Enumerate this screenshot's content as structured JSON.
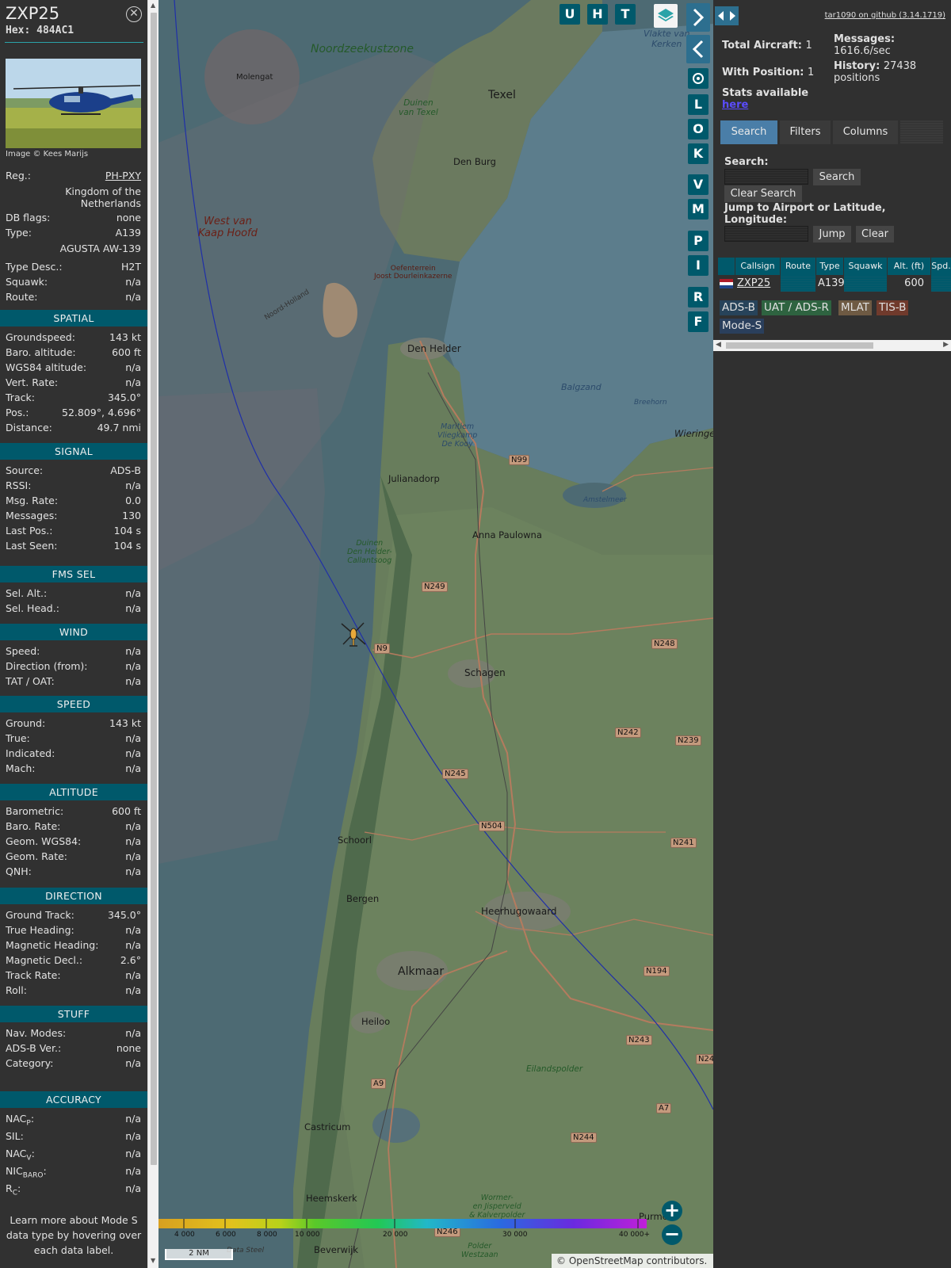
{
  "aircraft": {
    "callsign": "ZXP25",
    "hex": "Hex: 484AC1",
    "image_credit": "Image © Kees Marijs",
    "reg_label": "Reg.:",
    "reg": "PH-PXY",
    "country": "Kingdom of the Netherlands",
    "dbflags_label": "DB flags:",
    "dbflags": "none",
    "type_label": "Type:",
    "type": "A139",
    "type_full": "AGUSTA AW-139",
    "typedesc_label": "Type Desc.:",
    "typedesc": "H2T",
    "squawk_label": "Squawk:",
    "squawk": "n/a",
    "route_label": "Route:",
    "route": "n/a"
  },
  "sections": {
    "spatial": "SPATIAL",
    "signal": "SIGNAL",
    "fms": "FMS SEL",
    "wind": "WIND",
    "speed": "SPEED",
    "altitude": "ALTITUDE",
    "direction": "DIRECTION",
    "stuff": "STUFF",
    "accuracy": "ACCURACY"
  },
  "spatial": [
    {
      "label": "Groundspeed:",
      "value": "143 kt"
    },
    {
      "label": "Baro. altitude:",
      "value": "600 ft"
    },
    {
      "label": "WGS84 altitude:",
      "value": "n/a"
    },
    {
      "label": "Vert. Rate:",
      "value": "n/a"
    },
    {
      "label": "Track:",
      "value": "345.0°"
    },
    {
      "label": "Pos.:",
      "value": "52.809°, 4.696°"
    },
    {
      "label": "Distance:",
      "value": "49.7 nmi"
    }
  ],
  "signal": [
    {
      "label": "Source:",
      "value": "ADS-B"
    },
    {
      "label": "RSSI:",
      "value": "n/a"
    },
    {
      "label": "Msg. Rate:",
      "value": "0.0"
    },
    {
      "label": "Messages:",
      "value": "130"
    },
    {
      "label": "Last Pos.:",
      "value": "104 s"
    },
    {
      "label": "Last Seen:",
      "value": "104 s"
    }
  ],
  "fms": [
    {
      "label": "Sel. Alt.:",
      "value": "n/a"
    },
    {
      "label": "Sel. Head.:",
      "value": "n/a"
    }
  ],
  "wind": [
    {
      "label": "Speed:",
      "value": "n/a"
    },
    {
      "label": "Direction (from):",
      "value": "n/a"
    },
    {
      "label": "TAT / OAT:",
      "value": "n/a"
    }
  ],
  "speed": [
    {
      "label": "Ground:",
      "value": "143 kt"
    },
    {
      "label": "True:",
      "value": "n/a"
    },
    {
      "label": "Indicated:",
      "value": "n/a"
    },
    {
      "label": "Mach:",
      "value": "n/a"
    }
  ],
  "altitude": [
    {
      "label": "Barometric:",
      "value": "600 ft"
    },
    {
      "label": "Baro. Rate:",
      "value": "n/a"
    },
    {
      "label": "Geom. WGS84:",
      "value": "n/a"
    },
    {
      "label": "Geom. Rate:",
      "value": "n/a"
    },
    {
      "label": "QNH:",
      "value": "n/a"
    }
  ],
  "direction": [
    {
      "label": "Ground Track:",
      "value": "345.0°"
    },
    {
      "label": "True Heading:",
      "value": "n/a"
    },
    {
      "label": "Magnetic Heading:",
      "value": "n/a"
    },
    {
      "label": "Magnetic Decl.:",
      "value": "2.6°"
    },
    {
      "label": "Track Rate:",
      "value": "n/a"
    },
    {
      "label": "Roll:",
      "value": "n/a"
    }
  ],
  "stuff": [
    {
      "label": "Nav. Modes:",
      "value": "n/a"
    },
    {
      "label": "ADS-B Ver.:",
      "value": "none"
    },
    {
      "label": "Category:",
      "value": "n/a"
    }
  ],
  "accuracy": [
    {
      "label": "NAC",
      "sub": "P",
      "value": "n/a"
    },
    {
      "label": "SIL:",
      "sub": "",
      "value": "n/a"
    },
    {
      "label": "NAC",
      "sub": "V",
      "value": "n/a"
    },
    {
      "label": "NIC",
      "sub": "BARO",
      "value": "n/a"
    },
    {
      "label": "R",
      "sub": "C",
      "value": "n/a"
    }
  ],
  "footnote": "Learn more about Mode S data type by hovering over each data label.",
  "map": {
    "buttons_top": [
      "U",
      "H",
      "T"
    ],
    "buttons_side": [
      "L",
      "O",
      "K",
      "V",
      "M",
      "P",
      "I",
      "R",
      "F"
    ],
    "labels": {
      "noordzeekustzone": "Noordzeekustzone",
      "molengat": "Molengat",
      "texel": "Texel",
      "duinen_texel": "Duinen\nvan Texel",
      "den_burg": "Den Burg",
      "vlakte": "Vlakte van\nKerken",
      "west_van_kaap": "West van\nKaap Hoofd",
      "oefenterrein": "Oefenterrein\nJoost Dourleinkazerne",
      "noord_holland": "Noord-Holland",
      "den_helder": "Den Helder",
      "balgzand": "Balgzand",
      "breehorn": "Breehorn",
      "wieringen": "Wieringe",
      "maritiem": "Maritiem\nVliegkamp\nDe Kooy",
      "julianadorp": "Julianadorp",
      "amstelmeer": "Amstelmeer",
      "anna_paulowna": "Anna Paulowna",
      "duinen_den_helder": "Duinen\nDen Helder-\nCallantsoog",
      "schagen": "Schagen",
      "schoorl": "Schoorl",
      "bergen": "Bergen",
      "heerhugowaard": "Heerhugowaard",
      "alkmaar": "Alkmaar",
      "heiloo": "Heiloo",
      "eilandspolder": "Eilandspolder",
      "castricum": "Castricum",
      "heemskerk": "Heemskerk",
      "wormer": "Wormer-\nen Jisperveld\n& Kalverpolder",
      "purmerend": "Purmer",
      "beverwijk": "Beverwijk",
      "polder_westzaan": "Polder\nWestzaan",
      "data_steel": "Data Steel"
    },
    "roads": [
      "N99",
      "N249",
      "N9",
      "N248",
      "N242",
      "N239",
      "N245",
      "N504",
      "N241",
      "N194",
      "N243",
      "A9",
      "N244",
      "A7",
      "N246",
      "N24"
    ],
    "altitude_scale": [
      "4 000",
      "6 000",
      "8 000",
      "10 000",
      "20 000",
      "30 000",
      "40 000+"
    ],
    "scale": "2 NM",
    "attribution": "© OpenStreetMap contributors."
  },
  "side": {
    "github": "tar1090 on github (3.14.1719)",
    "total_aircraft_label": "Total Aircraft:",
    "total_aircraft": "1",
    "with_position_label": "With Position:",
    "with_position": "1",
    "messages_label": "Messages:",
    "messages": "1616.6/sec",
    "history_label": "History:",
    "history": "27438 positions",
    "stats_label": "Stats available",
    "stats_link": "here",
    "tabs": [
      "Search",
      "Filters",
      "Columns"
    ],
    "search_label": "Search:",
    "search_button": "Search",
    "clear_search_button": "Clear Search",
    "jump_label": "Jump to Airport or Latitude, Longitude:",
    "jump_button": "Jump",
    "clear_button": "Clear",
    "columns": [
      "Callsign",
      "Route",
      "Type",
      "Squawk",
      "Alt. (ft)",
      "Spd."
    ],
    "row": {
      "callsign": "ZXP25",
      "route": "",
      "type": "A139",
      "squawk": "",
      "alt": "600"
    },
    "legend": [
      {
        "label": "ADS-B",
        "color": "#27435a"
      },
      {
        "label": "UAT / ADS-R",
        "color": "#2e6340"
      },
      {
        "label": "MLAT",
        "color": "#6e5a43"
      },
      {
        "label": "TIS-B",
        "color": "#703a2c"
      },
      {
        "label": "Mode-S",
        "color": "#2a3f5c"
      }
    ]
  }
}
